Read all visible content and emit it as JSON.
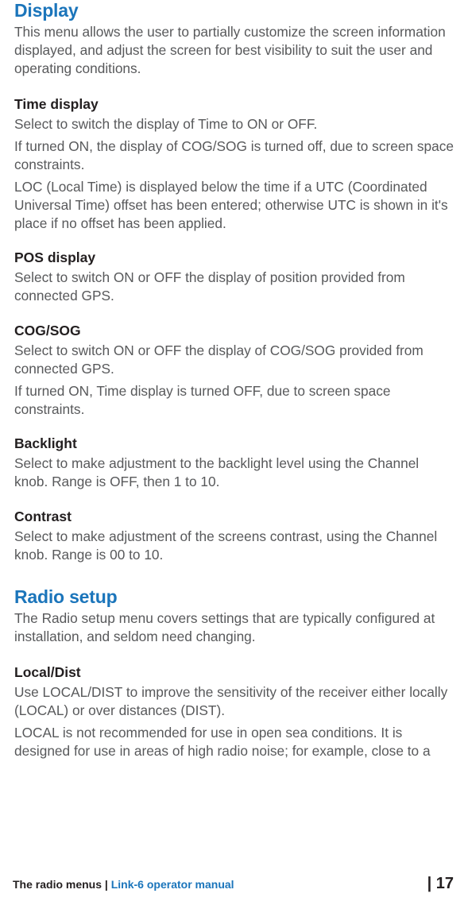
{
  "sections": {
    "display": {
      "title": "Display",
      "intro": "This menu allows the user to partially customize the screen information displayed, and adjust the screen for best visibility to suit the user and operating conditions."
    },
    "time_display": {
      "title": "Time display",
      "p1": "Select to switch the display of Time to ON or OFF.",
      "p2": "If turned ON, the display of COG/SOG is turned off, due to screen space constraints.",
      "p3": "LOC (Local Time) is displayed below the time if a UTC (Coordinated Universal Time) offset has been entered; otherwise UTC is shown in it's place if no offset has been applied."
    },
    "pos_display": {
      "title": "POS display",
      "p1": "Select to switch ON or OFF the display of position provided from connected GPS."
    },
    "cog_sog": {
      "title": "COG/SOG",
      "p1": "Select to switch ON or OFF the display of COG/SOG provided from connected GPS.",
      "p2": "If turned ON, Time display is turned OFF, due to screen space constraints."
    },
    "backlight": {
      "title": "Backlight",
      "p1": "Select to make adjustment to the backlight level using the Channel knob. Range is OFF, then 1 to 10."
    },
    "contrast": {
      "title": "Contrast",
      "p1": "Select to make adjustment of the screens contrast, using the Channel knob. Range is 00 to 10."
    },
    "radio_setup": {
      "title": "Radio setup",
      "intro": "The Radio setup menu covers settings that are typically configured at installation, and seldom need changing."
    },
    "local_dist": {
      "title": "Local/Dist",
      "p1": "Use LOCAL/DIST to improve the sensitivity of the receiver either locally (LOCAL) or over distances (DIST).",
      "p2": "LOCAL is not recommended for use in open sea conditions. It is designed for use in areas of high radio noise; for example, close to a"
    }
  },
  "footer": {
    "section_name": "The radio menus",
    "manual_name": "Link-6 operator manual",
    "page_number": "17"
  }
}
